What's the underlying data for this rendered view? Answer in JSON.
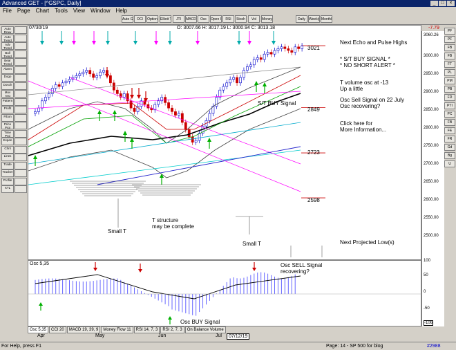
{
  "window": {
    "title": "Advanced GET - [^GSPC, Daily]"
  },
  "menu": [
    "File",
    "Page",
    "Chart",
    "Tools",
    "View",
    "Window",
    "Help"
  ],
  "toolbar_left": [
    "Auto Draw",
    "Auto Trend",
    "Adv Trend",
    "Bull Trend",
    "Bear Trend",
    "Alarm",
    "Dogo",
    "Dosch",
    "Mov Avg",
    "Pattern",
    "Profit",
    "Fibon",
    "Price Proj",
    "Time Proj",
    "Expan",
    "Chnl",
    "Lines",
    "Trade",
    "Tracker",
    "Profile",
    "XTL"
  ],
  "toolbar_top": [
    "Auto GET",
    "OCI",
    "Option",
    "Elliott Trig",
    "JTI",
    "MACD",
    "Osc",
    "Open Int",
    "RSI",
    "Stoch",
    "Vol",
    "Money Flow",
    "Daily",
    "Weekly",
    "Monthly"
  ],
  "toolbar_right": [
    "PF",
    "PF",
    "FB",
    "FB",
    "FT",
    "PL",
    "PM",
    "PB",
    "FD",
    "PTI",
    "PC",
    "FB",
    "FE",
    "FR",
    "Gd",
    "Bg",
    "U"
  ],
  "chart": {
    "date": "07/30/19",
    "ohlc": "O: 3007.66   H: 3017.19   L: 3000.94   C: 3013.18",
    "change": "-7.79",
    "price_label": "3060.26",
    "y_ticks": [
      "3000.00",
      "2950.00",
      "2900.00",
      "2850.00",
      "2800.00",
      "2750.00",
      "2700.00",
      "2650.00",
      "2600.00",
      "2550.00",
      "2500.00"
    ],
    "levels": [
      "3021",
      "2849",
      "2723",
      "2598"
    ],
    "annotations": {
      "next_echo": "Next Echo and Pulse Highs",
      "buy_signal": "* S/T BUY SIGNAL *",
      "no_short": "* NO SHORT ALERT *",
      "tvol": "T volume osc at -13",
      "up_little": "Up a little",
      "osc_sell": "Osc Sell Signal on 22 July",
      "osc_recovering": "Osc recovering?",
      "click_here": "Click here for",
      "more_info": "More Information...",
      "st_buy": "S/T BUY Signal",
      "small_t1": "Small T",
      "t_structure": "T structure",
      "may_complete": "may be complete",
      "small_t2": "Small T",
      "next_low": "Next Projected Low(s)"
    }
  },
  "osc": {
    "label": "Osc 5,35",
    "ticks": [
      "100",
      "50",
      "0",
      "-50",
      "-106"
    ],
    "sell": "Osc SELL Signal",
    "recovering": "recovering?",
    "buy": "Osc BUY Signal"
  },
  "tabs": [
    "Osc 5,35",
    "CCI 20",
    "MACD 19, 39, 9",
    "Money Flow 11",
    "RSI 14, 7, 3",
    "RSI 2, 7, 3",
    "On Balance Volume"
  ],
  "xaxis": {
    "labels": [
      "Apr",
      "May",
      "Jun",
      "Jul"
    ],
    "cursor": "07/12/19"
  },
  "status": {
    "help": "For Help, press F1",
    "page": "Page: 14 - SP 500 for blog",
    "id": "#2988"
  },
  "colors": {
    "up": "#0000ff",
    "down": "#cc0000",
    "signal_up": "#00b000",
    "signal_down": "#cc0000",
    "pink": "#ff00ff",
    "teal": "#00a0a0"
  }
}
